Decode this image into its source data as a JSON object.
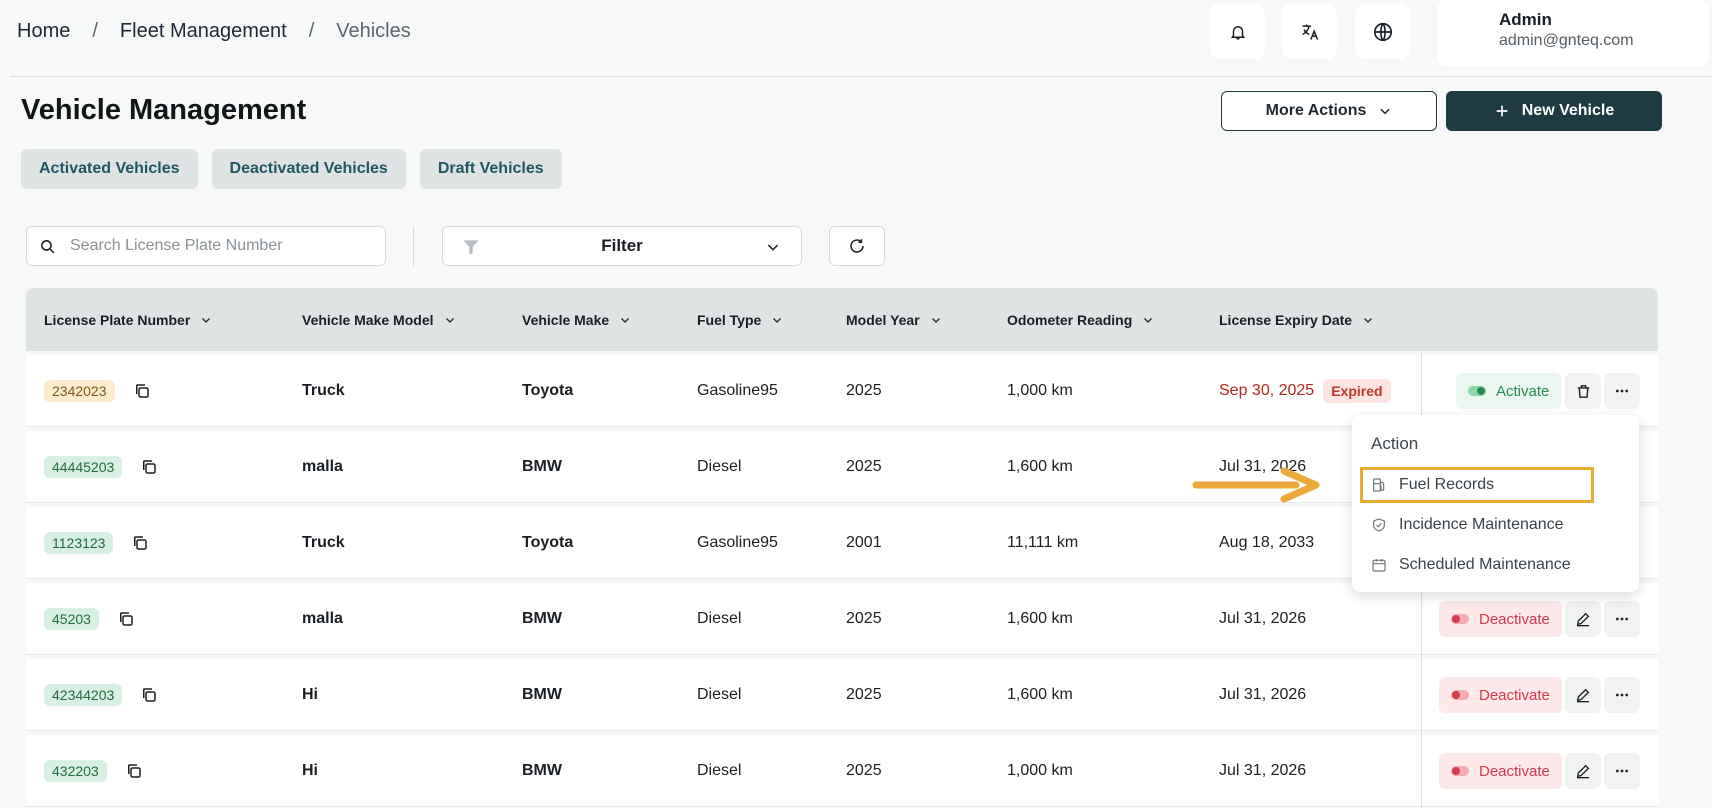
{
  "breadcrumb": {
    "home": "Home",
    "sep": "/",
    "fleet": "Fleet Management",
    "current": "Vehicles"
  },
  "header": {
    "icons": [
      "bell-icon",
      "translate-icon",
      "globe-icon"
    ],
    "user": {
      "name": "Admin",
      "email": "admin@gnteq.com"
    }
  },
  "page": {
    "title": "Vehicle Management",
    "more_actions": "More Actions",
    "new_vehicle": "New Vehicle"
  },
  "tabs": [
    "Activated Vehicles",
    "Deactivated Vehicles",
    "Draft Vehicles"
  ],
  "search": {
    "placeholder": "Search License Plate Number",
    "value": ""
  },
  "filter": {
    "label": "Filter"
  },
  "table": {
    "columns": [
      "License Plate Number",
      "Vehicle Make Model",
      "Vehicle Make",
      "Fuel Type",
      "Model Year",
      "Odometer Reading",
      "License Expiry Date"
    ],
    "rows": [
      {
        "plate": "2342023",
        "model": "Truck",
        "make": "Toyota",
        "fuel": "Gasoline95",
        "year": "2025",
        "odometer": "1,000 km",
        "expiry": "Sep 30, 2025",
        "badge": "Expired",
        "status": "Activate"
      },
      {
        "plate": "44445203",
        "model": "malla",
        "make": "BMW",
        "fuel": "Diesel",
        "year": "2025",
        "odometer": "1,600 km",
        "expiry": "Jul 31, 2026"
      },
      {
        "plate": "1123123",
        "model": "Truck",
        "make": "Toyota",
        "fuel": "Gasoline95",
        "year": "2001",
        "odometer": "11,111 km",
        "expiry": "Aug 18, 2033"
      },
      {
        "plate": "45203",
        "model": "malla",
        "make": "BMW",
        "fuel": "Diesel",
        "year": "2025",
        "odometer": "1,600 km",
        "expiry": "Jul 31, 2026",
        "status": "Deactivate"
      },
      {
        "plate": "42344203",
        "model": "Hi",
        "make": "BMW",
        "fuel": "Diesel",
        "year": "2025",
        "odometer": "1,600 km",
        "expiry": "Jul 31, 2026",
        "status": "Deactivate"
      },
      {
        "plate": "432203",
        "model": "Hi",
        "make": "BMW",
        "fuel": "Diesel",
        "year": "2025",
        "odometer": "1,000 km",
        "expiry": "Jul 31, 2026",
        "status": "Deactivate"
      }
    ]
  },
  "action_menu": {
    "title": "Action",
    "items": [
      "Fuel Records",
      "Incidence Maintenance",
      "Scheduled Maintenance"
    ]
  },
  "colors": {
    "primary": "#1d3b40",
    "highlight": "#e8ac32",
    "active": "#2b8a52",
    "danger": "#d43a4a"
  }
}
